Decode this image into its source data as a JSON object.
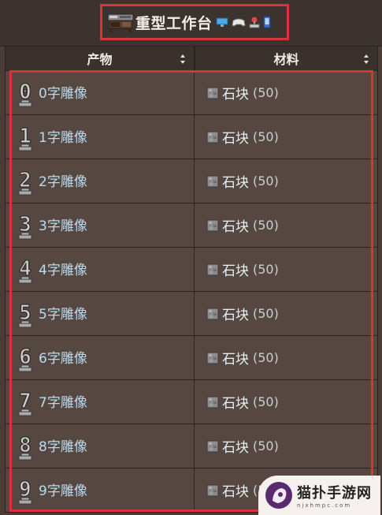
{
  "title": {
    "text": "重型工作台",
    "platforms": [
      "pc-icon",
      "gamepad-icon",
      "joystick-icon",
      "mobile-icon"
    ]
  },
  "columns": [
    {
      "label": "产物"
    },
    {
      "label": "材料"
    }
  ],
  "rows": [
    {
      "glyph": "0",
      "product": "0字雕像",
      "material": "石块",
      "count": "(50)"
    },
    {
      "glyph": "1",
      "product": "1字雕像",
      "material": "石块",
      "count": "(50)"
    },
    {
      "glyph": "2",
      "product": "2字雕像",
      "material": "石块",
      "count": "(50)"
    },
    {
      "glyph": "3",
      "product": "3字雕像",
      "material": "石块",
      "count": "(50)"
    },
    {
      "glyph": "4",
      "product": "4字雕像",
      "material": "石块",
      "count": "(50)"
    },
    {
      "glyph": "5",
      "product": "5字雕像",
      "material": "石块",
      "count": "(50)"
    },
    {
      "glyph": "6",
      "product": "6字雕像",
      "material": "石块",
      "count": "(50)"
    },
    {
      "glyph": "7",
      "product": "7字雕像",
      "material": "石块",
      "count": "(50)"
    },
    {
      "glyph": "8",
      "product": "8字雕像",
      "material": "石块",
      "count": "(50)"
    },
    {
      "glyph": "9",
      "product": "9字雕像",
      "material": "石块",
      "count": "(5"
    }
  ],
  "watermark": {
    "main": "猫扑手游网",
    "sub": "njxhmpc.com"
  },
  "colors": {
    "highlight": "#d8323b",
    "product_text": "#b8dcee",
    "cell_bg": "#564741"
  }
}
